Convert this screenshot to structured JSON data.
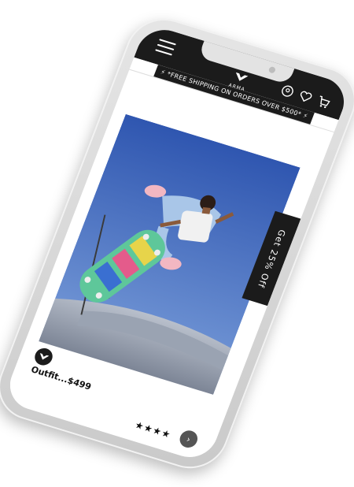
{
  "header": {
    "logo_text": "ARMA",
    "icons": [
      "menu-icon",
      "user-icon",
      "heart-icon",
      "cart-icon"
    ]
  },
  "promo": {
    "text": "⚡ *FREE SHIPPING ON ORDERS OVER $500* ⚡"
  },
  "side_tab": {
    "label": "Get 25% Off"
  },
  "product": {
    "caption": "Outfit...$499",
    "rating_stars": "★★★★",
    "next_icon": "chevron-right-icon"
  },
  "colors": {
    "dark": "#1b1b1b",
    "phone_body": "#d9d9d9",
    "sky": "#3c63b7",
    "skate_deck": "#5ec79a"
  }
}
